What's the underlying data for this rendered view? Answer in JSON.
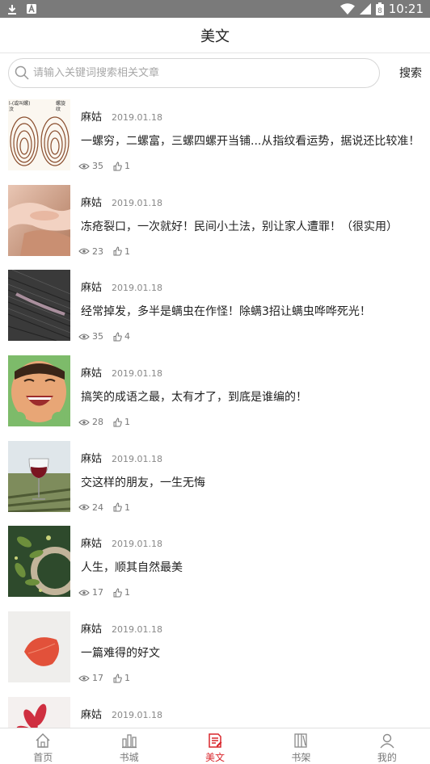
{
  "status_bar": {
    "time": "10:21",
    "battery": "8"
  },
  "header": {
    "title": "美文"
  },
  "search": {
    "placeholder": "请输入关键词搜索相关文章",
    "button_label": "搜索"
  },
  "articles": [
    {
      "author": "麻姑",
      "date": "2019.01.18",
      "title": "一螺穷，二螺富，三螺四螺开当铺...从指纹看运势，据说还比较准！",
      "views": "35",
      "likes": "1",
      "thumb": "fingerprint",
      "thumb_text_left": "l-(或叫螺)",
      "thumb_text_left2": "汶",
      "thumb_text_right": "螺旋",
      "thumb_text_right2": "纹"
    },
    {
      "author": "麻姑",
      "date": "2019.01.18",
      "title": "冻疮裂口，一次就好！民间小土法，别让家人遭罪！（很实用）",
      "views": "23",
      "likes": "1",
      "thumb": "hands"
    },
    {
      "author": "麻姑",
      "date": "2019.01.18",
      "title": "经常掉发，多半是螨虫在作怪！除螨3招让螨虫哗哗死光！",
      "views": "35",
      "likes": "4",
      "thumb": "hair"
    },
    {
      "author": "麻姑",
      "date": "2019.01.18",
      "title": "搞笑的成语之最，太有才了，到底是谁编的！",
      "views": "28",
      "likes": "1",
      "thumb": "child"
    },
    {
      "author": "麻姑",
      "date": "2019.01.18",
      "title": "交这样的朋友，一生无悔",
      "views": "24",
      "likes": "1",
      "thumb": "wine"
    },
    {
      "author": "麻姑",
      "date": "2019.01.18",
      "title": "人生，顺其自然最美",
      "views": "17",
      "likes": "1",
      "thumb": "leaves"
    },
    {
      "author": "麻姑",
      "date": "2019.01.18",
      "title": "一篇难得的好文",
      "views": "17",
      "likes": "1",
      "thumb": "petal"
    },
    {
      "author": "麻姑",
      "date": "2019.01.18",
      "title": "",
      "views": "",
      "likes": "",
      "thumb": "flower"
    }
  ],
  "bottom_nav": [
    {
      "label": "首页",
      "icon": "home-icon",
      "active": false
    },
    {
      "label": "书城",
      "icon": "bookstore-icon",
      "active": false
    },
    {
      "label": "美文",
      "icon": "article-icon",
      "active": true
    },
    {
      "label": "书架",
      "icon": "bookshelf-icon",
      "active": false
    },
    {
      "label": "我的",
      "icon": "profile-icon",
      "active": false
    }
  ],
  "colors": {
    "accent": "#d9262c",
    "statusbar": "#7a7a7a"
  }
}
